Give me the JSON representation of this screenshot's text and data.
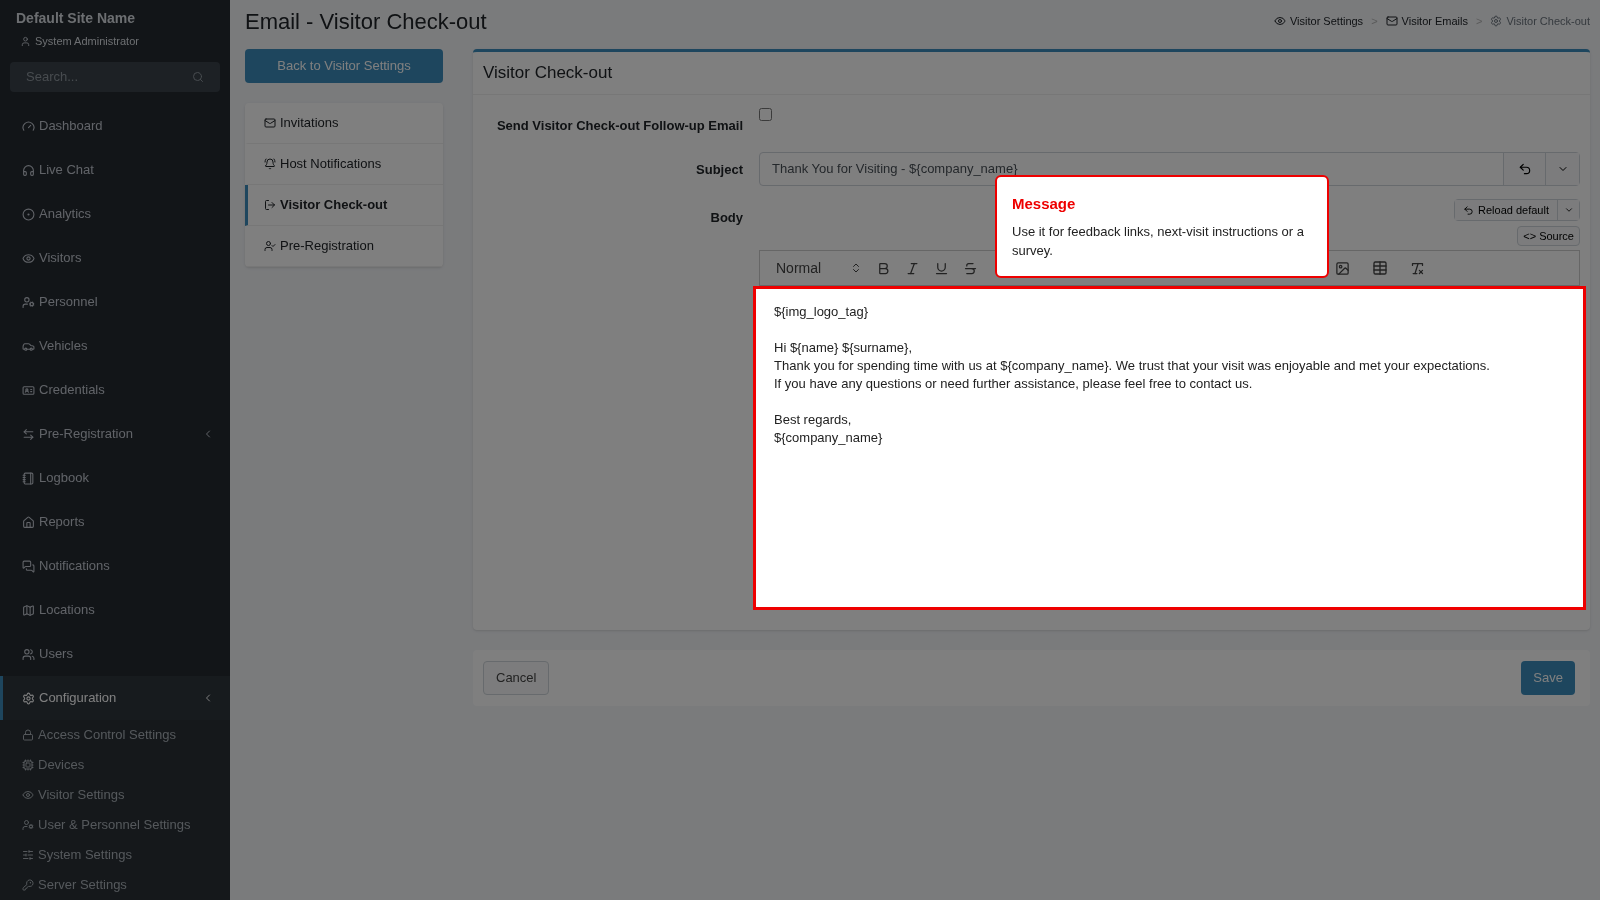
{
  "sidebar": {
    "site_name": "Default Site Name",
    "user": "System Administrator",
    "search": {
      "placeholder": "Search..."
    },
    "items": [
      {
        "label": "Dashboard",
        "selected": false,
        "submenu": false
      },
      {
        "label": "Live Chat",
        "selected": false,
        "submenu": false
      },
      {
        "label": "Analytics",
        "selected": false,
        "submenu": false
      },
      {
        "label": "Visitors",
        "selected": false,
        "submenu": false
      },
      {
        "label": "Personnel",
        "selected": false,
        "submenu": false
      },
      {
        "label": "Vehicles",
        "selected": false,
        "submenu": false
      },
      {
        "label": "Credentials",
        "selected": false,
        "submenu": false
      },
      {
        "label": "Pre-Registration",
        "selected": false,
        "submenu": true
      },
      {
        "label": "Logbook",
        "selected": false,
        "submenu": false
      },
      {
        "label": "Reports",
        "selected": false,
        "submenu": false
      },
      {
        "label": "Notifications",
        "selected": false,
        "submenu": false
      },
      {
        "label": "Locations",
        "selected": false,
        "submenu": false
      },
      {
        "label": "Users",
        "selected": false,
        "submenu": false
      },
      {
        "label": "Configuration",
        "selected": true,
        "submenu": true,
        "children": [
          {
            "label": "Access Control Settings"
          },
          {
            "label": "Devices"
          },
          {
            "label": "Visitor Settings"
          },
          {
            "label": "User & Personnel Settings"
          },
          {
            "label": "System Settings"
          },
          {
            "label": "Server Settings"
          }
        ]
      }
    ]
  },
  "page_title": "Email - Visitor Check-out",
  "breadcrumbs": [
    {
      "label": "Visitor Settings",
      "current": false
    },
    {
      "label": "Visitor Emails",
      "current": false
    },
    {
      "label": "Visitor Check-out",
      "current": true
    }
  ],
  "breadcrumb_separator": ">",
  "back_button": "Back to Visitor Settings",
  "tabs": [
    {
      "label": "Invitations",
      "selected": false
    },
    {
      "label": "Host Notifications",
      "selected": false
    },
    {
      "label": "Visitor Check-out",
      "selected": true
    },
    {
      "label": "Pre-Registration",
      "selected": false
    }
  ],
  "card": {
    "title": "Visitor Check-out",
    "follow_up": {
      "label": "Send Visitor Check-out Follow-up Email",
      "checked": false
    },
    "subject": {
      "label": "Subject",
      "value": "Thank You for Visiting - ${company_name}"
    },
    "body": {
      "label": "Body",
      "reload_button": "Reload default",
      "source_button": "<> Source",
      "format_select": "Normal",
      "paragraphs": [
        [
          "${img_logo_tag}"
        ],
        [
          "Hi ${name} ${surname},",
          "Thank you for spending time with us at ${company_name}. We trust that your visit was enjoyable and met your expectations.",
          "If you have any questions or need further assistance, please feel free to contact us."
        ],
        [
          "Best regards,",
          "${company_name}"
        ]
      ]
    }
  },
  "tooltip": {
    "title": "Message",
    "text": "Use it for feedback links, next-visit instructions or a survey."
  },
  "footer": {
    "cancel": "Cancel",
    "save": "Save"
  }
}
